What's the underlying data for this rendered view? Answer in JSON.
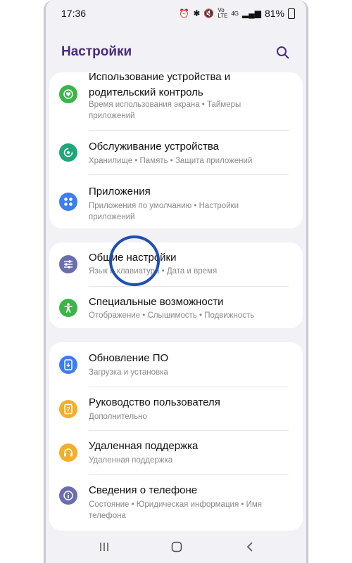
{
  "status_bar": {
    "time": "17:36",
    "network": "Vo LTE",
    "signal": "4G",
    "battery": "81%"
  },
  "header": {
    "title": "Настройки"
  },
  "groups": [
    {
      "items": [
        {
          "title": "Использование устройства и родительский контроль",
          "subtitle": "Время использования экрана • Таймеры приложений",
          "icon": "heart-settings-icon",
          "color": "#3bb54a"
        },
        {
          "title": "Обслуживание устройства",
          "subtitle": "Хранилище • Память • Защита приложений",
          "icon": "device-care-icon",
          "color": "#1fa77a"
        },
        {
          "title": "Приложения",
          "subtitle": "Приложения по умолчанию • Настройки приложений",
          "icon": "apps-grid-icon",
          "color": "#3d7df0"
        }
      ]
    },
    {
      "items": [
        {
          "title": "Общие настройки",
          "subtitle": "Язык и клавиатура • Дата и время",
          "icon": "sliders-icon",
          "color": "#6a6db0"
        },
        {
          "title": "Специальные возможности",
          "subtitle": "Отображение • Слышимость • Подвижность",
          "icon": "accessibility-icon",
          "color": "#3bb54a"
        }
      ]
    },
    {
      "items": [
        {
          "title": "Обновление ПО",
          "subtitle": "Загрузка и установка",
          "icon": "software-update-icon",
          "color": "#3d7df0"
        },
        {
          "title": "Руководство пользователя",
          "subtitle": "Дополнительно",
          "icon": "manual-icon",
          "color": "#f3ae2b"
        },
        {
          "title": "Удаленная поддержка",
          "subtitle": "Удаленная поддержка",
          "icon": "headset-icon",
          "color": "#f3ae2b"
        },
        {
          "title": "Сведения о телефоне",
          "subtitle": "Состояние • Юридическая информация • Имя телефона",
          "icon": "info-icon",
          "color": "#6a6db0"
        }
      ]
    }
  ]
}
